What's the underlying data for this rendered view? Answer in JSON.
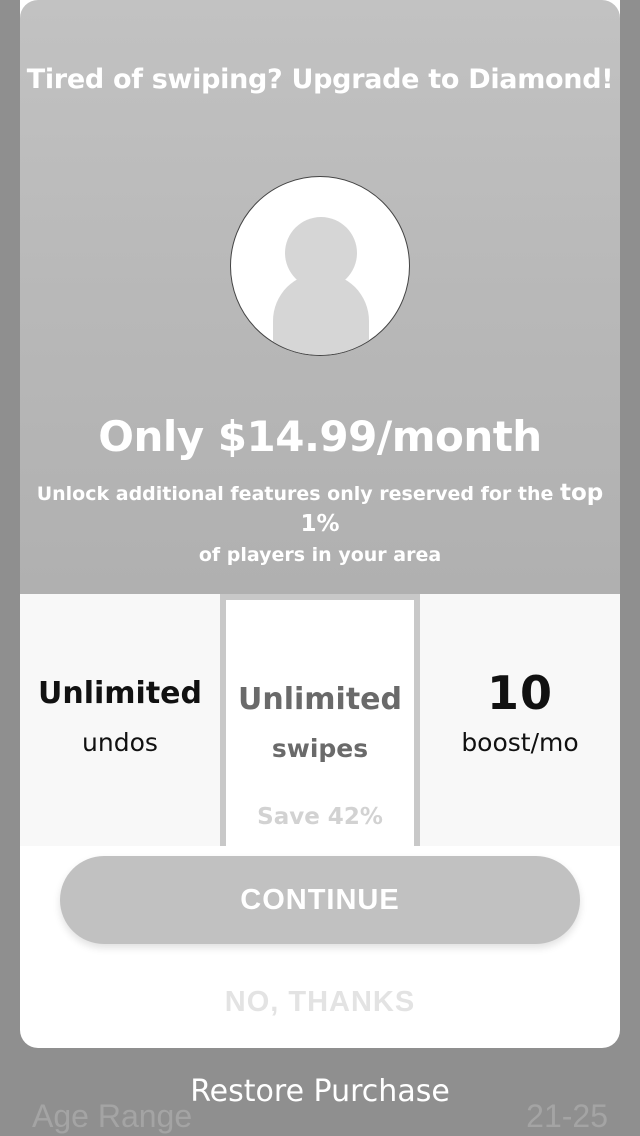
{
  "background": {
    "age_range_label": "Age Range",
    "age_range_value": "21-25"
  },
  "modal": {
    "headline": "Tired of swiping? Upgrade to Diamond!",
    "price": "Only $14.99/month",
    "subtitle_part1": "Unlock additional features only reserved for the ",
    "subtitle_emphasis": "top 1%",
    "subtitle_part2": "of players in your area",
    "features": [
      {
        "title": "Unlimited",
        "subtitle": "undos"
      },
      {
        "title": "Unlimited",
        "subtitle": "swipes",
        "note": "Save 42%"
      },
      {
        "title": "10",
        "subtitle": "boost/mo"
      }
    ],
    "continue_label": "CONTINUE",
    "no_thanks_label": "NO, THANKS"
  },
  "restore_label": "Restore Purchase",
  "colors": {
    "header_gray": "#bcbcbc",
    "button_gray": "#c1c1c1",
    "selected_border": "#c8c8c8"
  }
}
